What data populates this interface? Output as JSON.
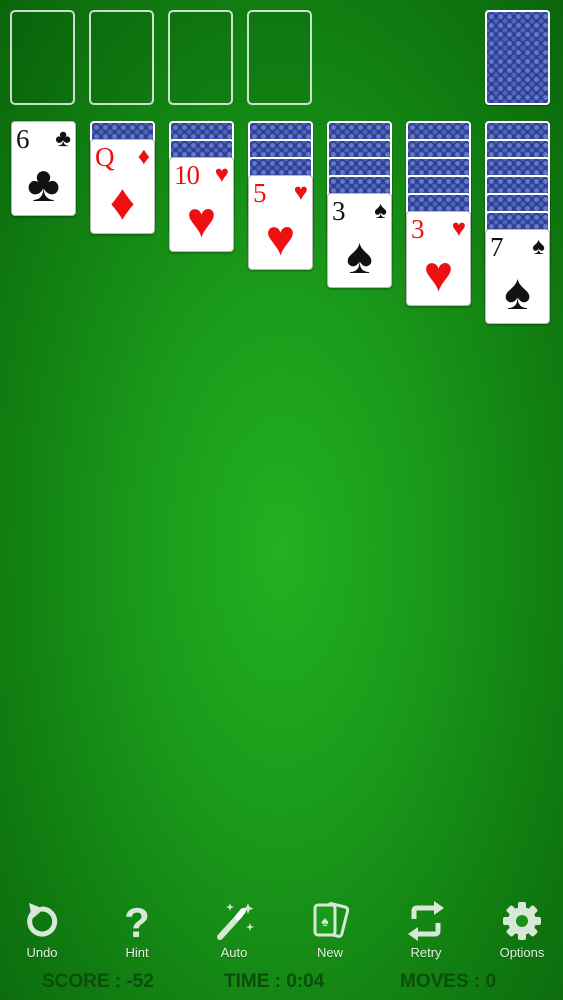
{
  "colors": {
    "red_suit": "#ee1010",
    "black_suit": "#111111",
    "felt": "#1a9a1a",
    "card_back": "#2b3f95"
  },
  "foundations": [
    "",
    "",
    "",
    ""
  ],
  "stock": {
    "face_down_shown": 1
  },
  "tableau": [
    {
      "hidden": 0,
      "top": {
        "rank": "6",
        "suit": "♣",
        "color": "black"
      }
    },
    {
      "hidden": 1,
      "top": {
        "rank": "Q",
        "suit": "♦",
        "color": "red"
      }
    },
    {
      "hidden": 2,
      "top": {
        "rank": "10",
        "suit": "♥",
        "color": "red"
      }
    },
    {
      "hidden": 3,
      "top": {
        "rank": "5",
        "suit": "♥",
        "color": "red"
      }
    },
    {
      "hidden": 4,
      "top": {
        "rank": "3",
        "suit": "♠",
        "color": "black"
      }
    },
    {
      "hidden": 5,
      "top": {
        "rank": "3",
        "suit": "♥",
        "color": "red"
      }
    },
    {
      "hidden": 6,
      "top": {
        "rank": "7",
        "suit": "♠",
        "color": "black"
      }
    }
  ],
  "toolbar": {
    "undo": {
      "label": "Undo",
      "icon": "undo-icon"
    },
    "hint": {
      "label": "Hint",
      "icon": "question-icon"
    },
    "auto": {
      "label": "Auto",
      "icon": "magic-wand-icon"
    },
    "new": {
      "label": "New",
      "icon": "cards-icon"
    },
    "retry": {
      "label": "Retry",
      "icon": "retry-icon"
    },
    "options": {
      "label": "Options",
      "icon": "gear-icon"
    }
  },
  "status": {
    "score": "SCORE : -52",
    "time": "TIME : 0:04",
    "moves": "MOVES : 0"
  }
}
